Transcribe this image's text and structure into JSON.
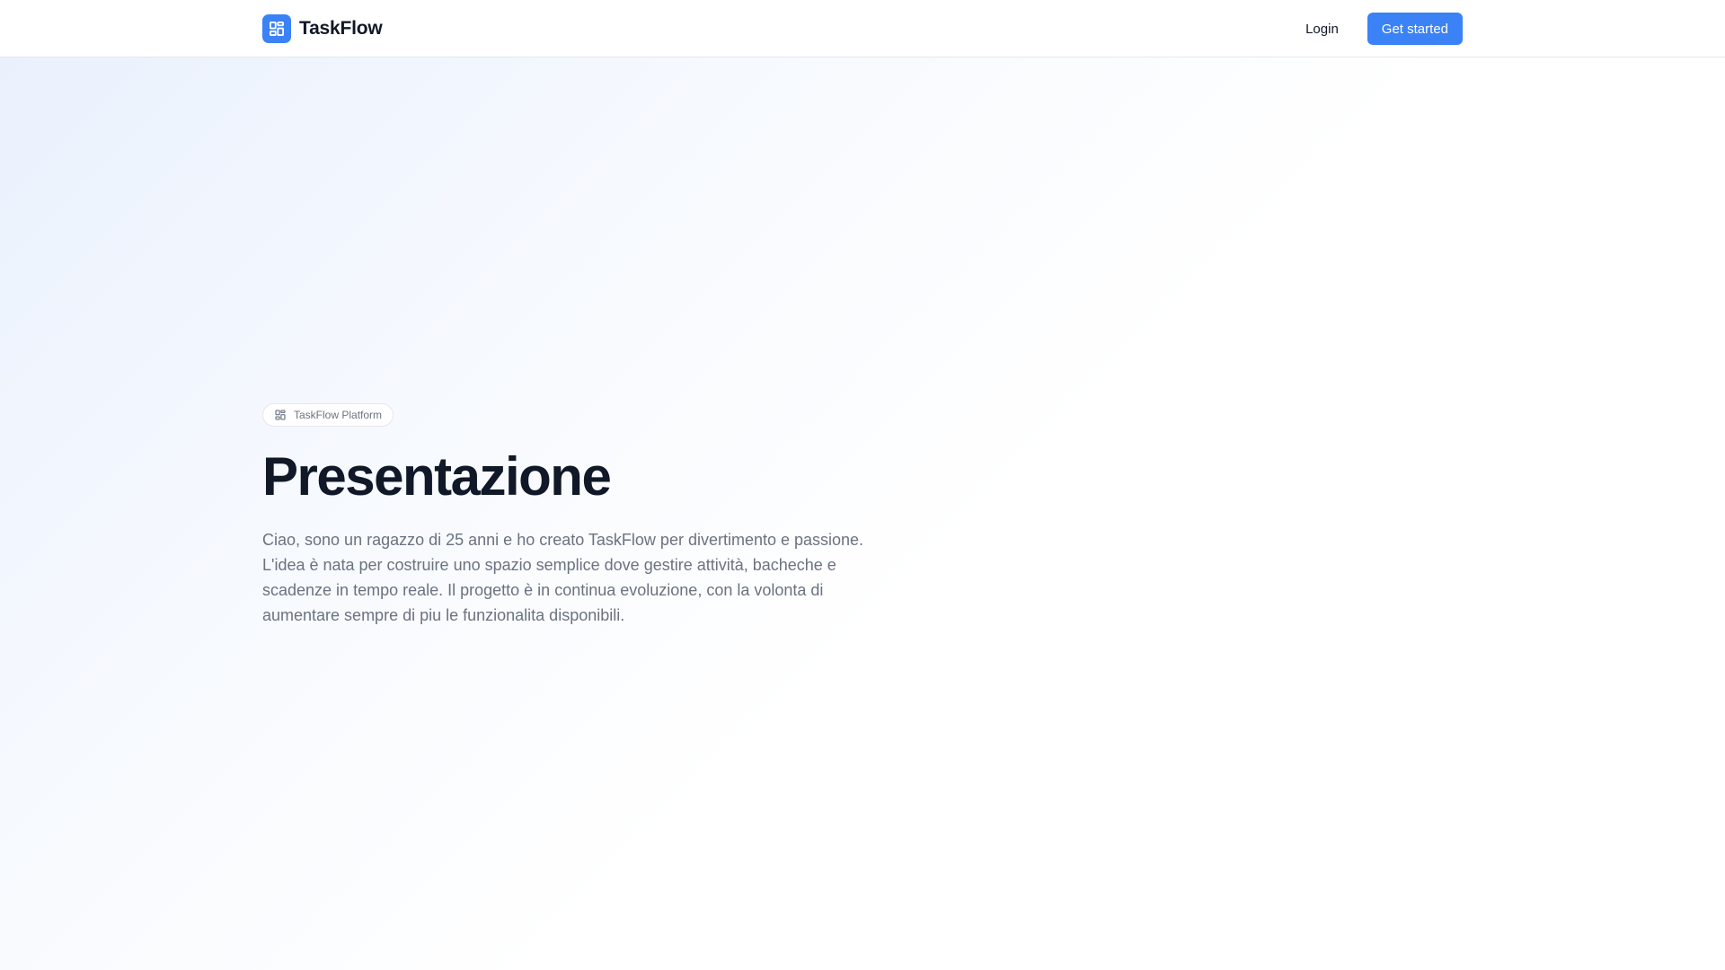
{
  "header": {
    "brand_name": "TaskFlow",
    "brand_icon": "dashboard-grid-icon",
    "login_label": "Login",
    "cta_label": "Get started"
  },
  "hero": {
    "badge_icon": "dashboard-grid-icon",
    "badge_label": "TaskFlow Platform",
    "title": "Presentazione",
    "description": "Ciao, sono un ragazzo di 25 anni e ho creato TaskFlow per divertimento e passione. L'idea è nata per costruire uno spazio semplice dove gestire attività, bacheche e scadenze in tempo reale. Il progetto è in continua evoluzione, con la volonta di aumentare sempre di piu le funzionalita disponibili."
  },
  "colors": {
    "accent": "#3b82f6",
    "text_primary": "#111827",
    "text_muted": "#6b7280",
    "border": "#e5e7eb"
  }
}
